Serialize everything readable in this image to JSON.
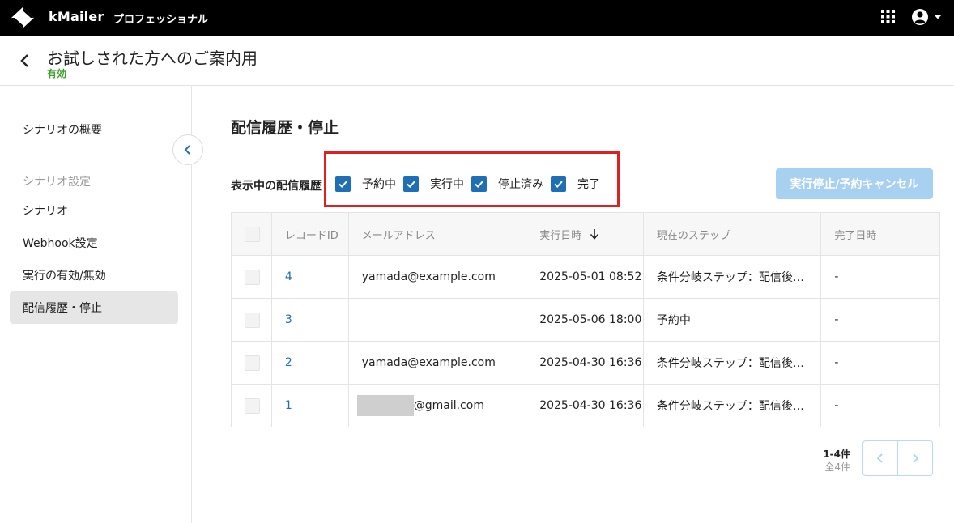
{
  "app": {
    "brand": "kMailer",
    "edition": "プロフェッショナル"
  },
  "header": {
    "title": "お試しされた方へのご案内用",
    "status": "有効",
    "status_color": "#3aa02c"
  },
  "sidebar": {
    "items": [
      {
        "label": "シナリオの概要"
      },
      {
        "label": "シナリオ設定"
      },
      {
        "label": "シナリオ"
      },
      {
        "label": "Webhook設定"
      },
      {
        "label": "実行の有効/無効"
      },
      {
        "label": "配信履歴・停止"
      }
    ]
  },
  "main": {
    "section_title": "配信履歴・停止",
    "filter_label": "表示中の配信履歴",
    "filters": [
      {
        "label": "予約中",
        "checked": true
      },
      {
        "label": "実行中",
        "checked": true
      },
      {
        "label": "停止済み",
        "checked": true
      },
      {
        "label": "完了",
        "checked": true
      }
    ],
    "stop_button": "実行停止/予約キャンセル"
  },
  "table": {
    "headers": [
      "レコードID",
      "メールアドレス",
      "実行日時",
      "現在のステップ",
      "完了日時"
    ],
    "rows": [
      {
        "id": "4",
        "email": "yamada@example.com",
        "executed": "2025-05-01 08:52",
        "step": "条件分岐ステップ：配信後…",
        "completed": "-"
      },
      {
        "id": "3",
        "email": "",
        "executed": "2025-05-06 18:00",
        "step": "予約中",
        "completed": "-"
      },
      {
        "id": "2",
        "email": "yamada@example.com",
        "executed": "2025-04-30 16:36",
        "step": "条件分岐ステップ：配信後…",
        "completed": "-"
      },
      {
        "id": "1",
        "email": "@gmail.com",
        "executed": "2025-04-30 16:36",
        "step": "条件分岐ステップ：配信後…",
        "completed": "-"
      }
    ]
  },
  "pagination": {
    "range": "1-4件",
    "total": "全4件"
  },
  "colors": {
    "accent": "#1f6fb5",
    "highlight": "#e02020",
    "disabled_button": "#a8d0f0"
  }
}
